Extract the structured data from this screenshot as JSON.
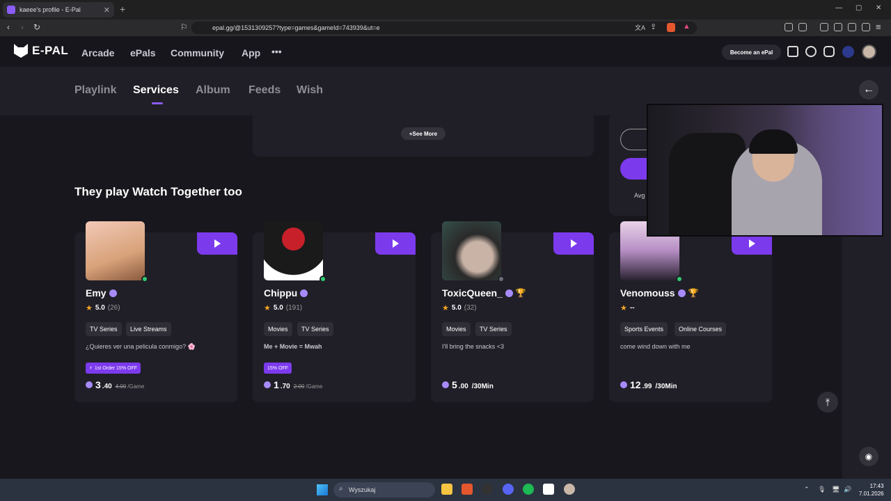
{
  "browser": {
    "tab_title": "kaeee's profile - E-Pal",
    "url": "epal.gg/@1531309257?type=games&gameId=743939&ut=e"
  },
  "site": {
    "logo": "E-PAL",
    "nav": [
      "Arcade",
      "ePals",
      "Community",
      "App"
    ],
    "more": "•••",
    "become": "Become an ePal"
  },
  "subnav": {
    "tabs": [
      "Playlink",
      "Services",
      "Album",
      "Feeds",
      "Wish"
    ],
    "active": "Services"
  },
  "see_more": "+See More",
  "right_panel": {
    "avg_label": "Avg"
  },
  "section_title": "They play Watch Together too",
  "cards": [
    {
      "name": "Emy",
      "rating": "5.0",
      "count": "(26)",
      "tags": [
        "TV Series",
        "Live Streams"
      ],
      "desc": "¿Quieres ver una pelicula conmigo? 🌸",
      "promo": "1st Order 15% OFF",
      "price_int": "3",
      "price_dec": ".40",
      "price_old": "4.00",
      "unit": "/Game",
      "status_color": "#2ecc71",
      "trophy": false
    },
    {
      "name": "Chippu",
      "rating": "5.0",
      "count": "(191)",
      "tags": [
        "Movies",
        "TV Series"
      ],
      "desc": "Me + Movie = Mwah",
      "promo": "15% OFF",
      "price_int": "1",
      "price_dec": ".70",
      "price_old": "2.00",
      "unit": "/Game",
      "status_color": "#2ecc71",
      "trophy": false
    },
    {
      "name": "ToxicQueen_",
      "rating": "5.0",
      "count": "(32)",
      "tags": [
        "Movies",
        "TV Series"
      ],
      "desc": "I'll bring the snacks <3",
      "promo": "",
      "price_int": "5",
      "price_dec": ".00",
      "price_old": "",
      "unit": "/30Min",
      "status_color": "#6b6b78",
      "trophy": true
    },
    {
      "name": "Venomouss",
      "rating": "--",
      "count": "",
      "tags": [
        "Sports Events",
        "Online Courses"
      ],
      "desc": "come wind down with me",
      "promo": "",
      "price_int": "12",
      "price_dec": ".99",
      "price_old": "",
      "unit": "/30Min",
      "status_color": "#2ecc71",
      "trophy": true
    }
  ],
  "taskbar": {
    "search": "Wyszukaj",
    "time": "17:43",
    "date": "7.01.2026"
  }
}
